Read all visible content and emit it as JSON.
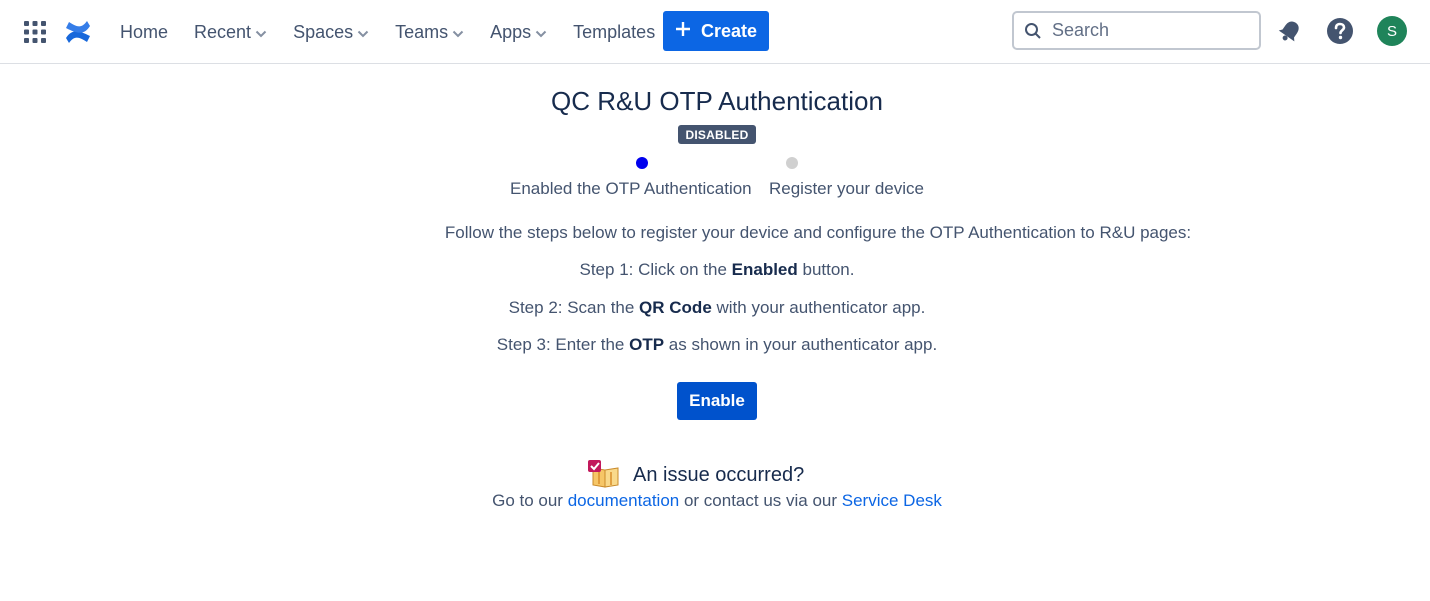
{
  "header": {
    "nav": [
      {
        "label": "Home",
        "has_dropdown": false
      },
      {
        "label": "Recent",
        "has_dropdown": true
      },
      {
        "label": "Spaces",
        "has_dropdown": true
      },
      {
        "label": "Teams",
        "has_dropdown": true
      },
      {
        "label": "Apps",
        "has_dropdown": true
      },
      {
        "label": "Templates",
        "has_dropdown": false
      }
    ],
    "create_label": "Create",
    "search_placeholder": "Search",
    "avatar_initial": "S"
  },
  "page": {
    "title": "QC R&U OTP Authentication",
    "status_badge": "DISABLED",
    "steps": [
      {
        "label": "Enabled the OTP Authentication",
        "active": true
      },
      {
        "label": "Register your device",
        "active": false
      }
    ],
    "intro": "Follow the steps below to register your device and configure the OTP Authentication to R&U pages:",
    "instructions": [
      {
        "prefix": "Step 1: Click on the ",
        "bold": "Enabled",
        "suffix": " button."
      },
      {
        "prefix": "Step 2: Scan the ",
        "bold": "QR Code",
        "suffix": " with your authenticator app."
      },
      {
        "prefix": "Step 3: Enter the ",
        "bold": "OTP",
        "suffix": " as shown in your authenticator app."
      }
    ],
    "enable_label": "Enable",
    "issue": {
      "heading": "An issue occurred?",
      "text_before": "Go to our ",
      "link_documentation": "documentation",
      "text_middle": " or contact us via our ",
      "link_service_desk": "Service Desk"
    }
  },
  "colors": {
    "create_button": "#0c66e4",
    "enable_button": "#0052cc",
    "badge": "#44546f",
    "active_step": "#0000ee",
    "inactive_step": "#d0d0d0",
    "avatar": "#1f845a",
    "link": "#0c66e4"
  },
  "icons": {
    "app_switcher": "grid-icon",
    "logo": "confluence-logo",
    "create": "plus-icon",
    "search": "search-icon",
    "notifications": "bell-icon",
    "help": "help-icon",
    "issue": "checklist-book-icon"
  }
}
